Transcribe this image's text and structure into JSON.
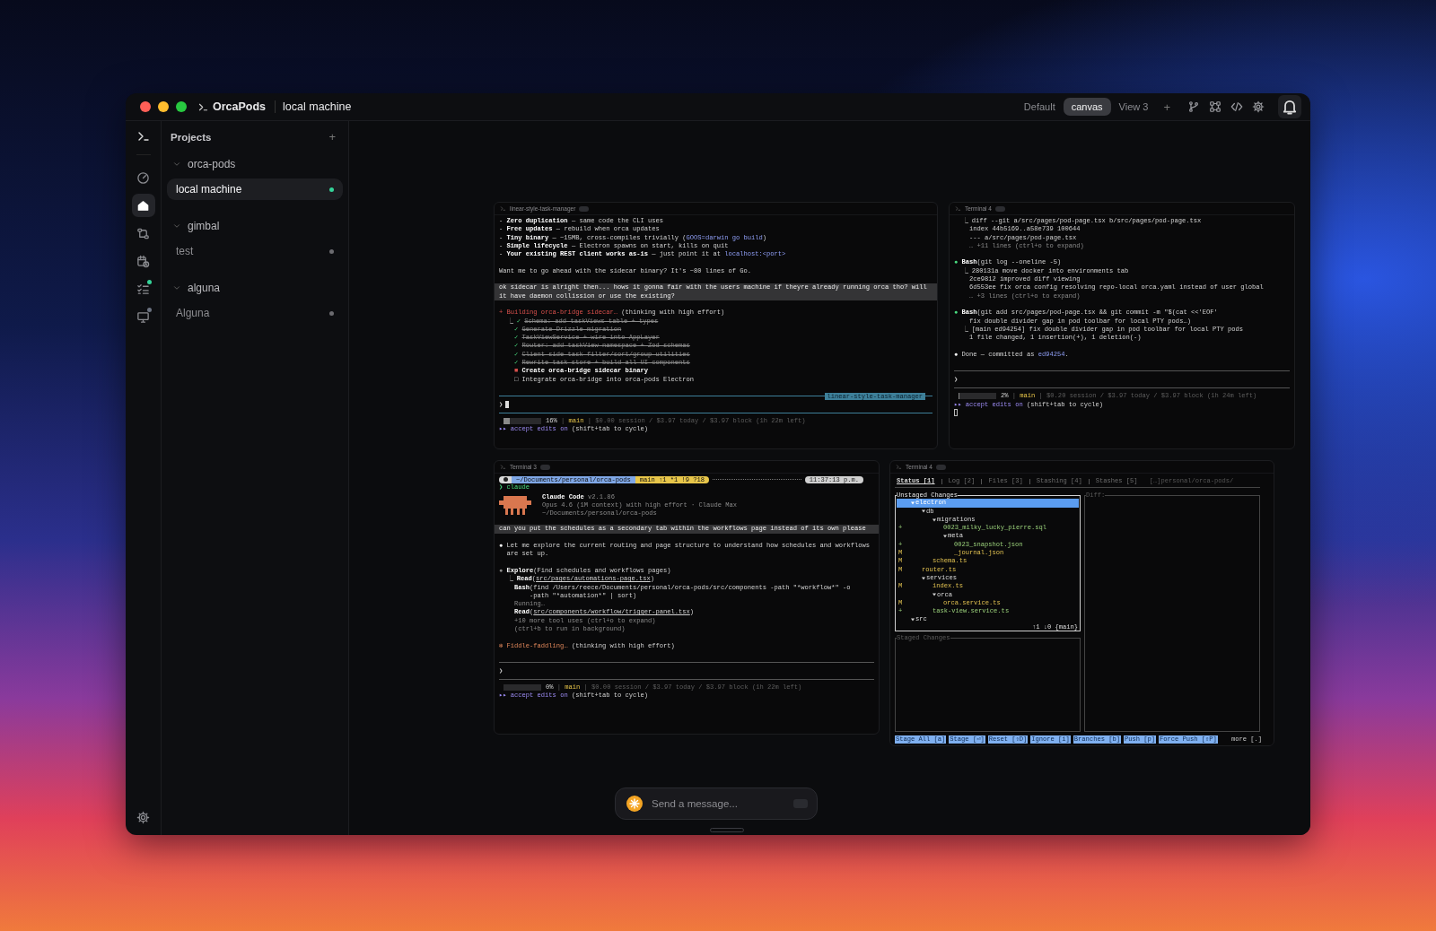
{
  "titlebar": {
    "app": "OrcaPods",
    "context": "local machine",
    "views": [
      {
        "label": "Default",
        "selected": false
      },
      {
        "label": "canvas",
        "selected": true
      },
      {
        "label": "View 3",
        "selected": false
      }
    ],
    "add_view": "+"
  },
  "rail": [
    {
      "selected": false
    },
    {
      "selected": true
    },
    {
      "selected": false
    },
    {
      "selected": false
    },
    {
      "selected": false,
      "color": "#34d399"
    },
    {
      "selected": false,
      "color": "#6b7280"
    }
  ],
  "projects": {
    "title": "Projects",
    "add": "+",
    "groups": [
      {
        "name": "orca-pods",
        "items": [
          {
            "label": "local machine",
            "selected": true,
            "color": "#34d399"
          }
        ]
      },
      {
        "name": "gimbal",
        "items": [
          {
            "label": "test",
            "selected": false,
            "color": "#6b6b70"
          }
        ]
      },
      {
        "name": "alguna",
        "items": [
          {
            "label": "Alguna",
            "selected": false,
            "color": "#6b6b70"
          }
        ]
      }
    ]
  },
  "terminals": [
    {
      "kind": "claude",
      "title": "linear-style-task-manager",
      "blocks": [
        {
          "kind": "line",
          "segments": [
            {
              "text": "- "
            },
            {
              "text": "Zero duplication",
              "kind": "bold"
            },
            {
              "text": " — same code the CLI uses"
            }
          ]
        },
        {
          "kind": "line",
          "segments": [
            {
              "text": "- "
            },
            {
              "text": "Free updates",
              "kind": "bold"
            },
            {
              "text": " — rebuild when orca updates"
            }
          ]
        },
        {
          "kind": "line",
          "segments": [
            {
              "text": "- "
            },
            {
              "text": "Tiny binary",
              "kind": "bold"
            },
            {
              "text": " — ~15MB, cross-compiles trivially ("
            },
            {
              "text": "GOOS=darwin go build",
              "kind": "link"
            },
            {
              "text": ")"
            }
          ]
        },
        {
          "kind": "line",
          "segments": [
            {
              "text": "- "
            },
            {
              "text": "Simple lifecycle",
              "kind": "bold"
            },
            {
              "text": " — Electron spawns on start, kills on quit"
            }
          ]
        },
        {
          "kind": "line",
          "segments": [
            {
              "text": "- "
            },
            {
              "text": "Your existing REST client works as-is",
              "kind": "bold"
            },
            {
              "text": " — just point it at "
            },
            {
              "text": "localhost:<port>",
              "kind": "link"
            }
          ]
        },
        {
          "kind": "blank"
        },
        {
          "kind": "line",
          "segments": [
            {
              "text": "Want me to go ahead with the sidecar binary? It's ~80 lines of Go."
            }
          ]
        },
        {
          "kind": "blank"
        },
        {
          "kind": "prompt",
          "text": "ok sidecar is alright then... hows it gonna fair with the users machine if theyre already running orca tho? will it have daemon collission or use the existing?"
        },
        {
          "kind": "blank"
        },
        {
          "kind": "line",
          "segments": [
            {
              "text": "+ Building orca-bridge sidecar…",
              "kind": "red"
            },
            {
              "text": " (thinking with high effort)"
            }
          ]
        },
        {
          "kind": "line",
          "segments": [
            {
              "kind": "indent"
            },
            {
              "text": "⎿ ",
              "kind": "dim"
            },
            {
              "text": "✓ ",
              "kind": "green"
            },
            {
              "text": "Schema: add taskViews table + types",
              "kind": "strike"
            }
          ]
        },
        {
          "kind": "line",
          "segments": [
            {
              "kind": "indent"
            },
            {
              "kind": "indent"
            },
            {
              "text": "✓ ",
              "kind": "green"
            },
            {
              "text": "Generate Drizzle migration",
              "kind": "strike"
            }
          ]
        },
        {
          "kind": "line",
          "segments": [
            {
              "kind": "indent"
            },
            {
              "kind": "indent"
            },
            {
              "text": "✓ ",
              "kind": "green"
            },
            {
              "text": "TaskViewService + wire into AppLayer",
              "kind": "strike"
            }
          ]
        },
        {
          "kind": "line",
          "segments": [
            {
              "kind": "indent"
            },
            {
              "kind": "indent"
            },
            {
              "text": "✓ ",
              "kind": "green"
            },
            {
              "text": "Router: add taskView namespace + Zod schemas",
              "kind": "strike"
            }
          ]
        },
        {
          "kind": "line",
          "segments": [
            {
              "kind": "indent"
            },
            {
              "kind": "indent"
            },
            {
              "text": "✓ ",
              "kind": "green"
            },
            {
              "text": "Client-side task filter/sort/group utilities",
              "kind": "strike"
            }
          ]
        },
        {
          "kind": "line",
          "segments": [
            {
              "kind": "indent"
            },
            {
              "kind": "indent"
            },
            {
              "text": "✓ ",
              "kind": "green"
            },
            {
              "text": "Rewrite task store + build all UI components",
              "kind": "strike"
            }
          ]
        },
        {
          "kind": "line",
          "segments": [
            {
              "kind": "indent"
            },
            {
              "kind": "indent"
            },
            {
              "text": "■ ",
              "kind": "red"
            },
            {
              "text": "Create orca-bridge sidecar binary",
              "kind": "bold"
            }
          ]
        },
        {
          "kind": "line",
          "segments": [
            {
              "kind": "indent"
            },
            {
              "kind": "indent"
            },
            {
              "text": "□ Integrate orca-bridge into orca-pods Electron"
            }
          ]
        },
        {
          "kind": "blank"
        },
        {
          "kind": "rule",
          "label": "linear-style-task-manager",
          "color": "#3d7f99"
        },
        {
          "kind": "input",
          "text": "❯",
          "cursor": true
        },
        {
          "kind": "rule",
          "color": "#3d7f99"
        },
        {
          "kind": "status",
          "level": 0.16,
          "segments": [
            {
              "text": "16%"
            },
            {
              "text": " | ",
              "kind": "faint"
            },
            {
              "text": "main",
              "kind": "yellow"
            },
            {
              "text": " | $0.00 session / $3.97 today / $3.97 block (1h 22m left)",
              "kind": "faint"
            }
          ]
        },
        {
          "kind": "line",
          "segments": [
            {
              "text": "▸▸ accept edits on",
              "kind": "purple"
            },
            {
              "text": " (shift+tab to cycle)"
            }
          ]
        }
      ]
    },
    {
      "kind": "claude",
      "title": "Terminal 4",
      "blocks": [
        {
          "kind": "line",
          "segments": [
            {
              "kind": "indent"
            },
            {
              "text": "⎿ ",
              "kind": "dim"
            },
            {
              "text": "diff --git a/src/pages/pod-page.tsx b/src/pages/pod-page.tsx"
            }
          ]
        },
        {
          "kind": "line",
          "segments": [
            {
              "kind": "indent"
            },
            {
              "kind": "indent"
            },
            {
              "text": "index 44b5169..a58e739 100644"
            }
          ]
        },
        {
          "kind": "line",
          "segments": [
            {
              "kind": "indent"
            },
            {
              "kind": "indent"
            },
            {
              "text": "--- a/src/pages/pod-page.tsx"
            }
          ]
        },
        {
          "kind": "line",
          "segments": [
            {
              "kind": "indent"
            },
            {
              "kind": "indent"
            },
            {
              "text": "… +11 lines (ctrl+o to expand)",
              "kind": "dim"
            }
          ]
        },
        {
          "kind": "blank"
        },
        {
          "kind": "line",
          "segments": [
            {
              "text": "● ",
              "kind": "green"
            },
            {
              "text": "Bash",
              "kind": "bold"
            },
            {
              "text": "(git log --oneline -5)"
            }
          ]
        },
        {
          "kind": "line",
          "segments": [
            {
              "kind": "indent"
            },
            {
              "text": "⎿ ",
              "kind": "dim"
            },
            {
              "text": "280131a move docker into environments tab"
            }
          ]
        },
        {
          "kind": "line",
          "segments": [
            {
              "kind": "indent"
            },
            {
              "kind": "indent"
            },
            {
              "text": "2ce9812 improved diff viewing"
            }
          ]
        },
        {
          "kind": "line",
          "segments": [
            {
              "kind": "indent"
            },
            {
              "kind": "indent"
            },
            {
              "text": "6d553ee fix orca config resolving repo-local orca.yaml instead of user global"
            }
          ]
        },
        {
          "kind": "line",
          "segments": [
            {
              "kind": "indent"
            },
            {
              "kind": "indent"
            },
            {
              "text": "… +3 lines (ctrl+o to expand)",
              "kind": "dim"
            }
          ]
        },
        {
          "kind": "blank"
        },
        {
          "kind": "line",
          "segments": [
            {
              "text": "● ",
              "kind": "green"
            },
            {
              "text": "Bash",
              "kind": "bold"
            },
            {
              "text": "(git add src/pages/pod-page.tsx && git commit -m \"$(cat <<'EOF'"
            }
          ]
        },
        {
          "kind": "line",
          "segments": [
            {
              "kind": "indent"
            },
            {
              "kind": "indent"
            },
            {
              "text": "fix double divider gap in pod toolbar for local PTY pods…)"
            }
          ]
        },
        {
          "kind": "line",
          "segments": [
            {
              "kind": "indent"
            },
            {
              "text": "⎿ ",
              "kind": "dim"
            },
            {
              "text": "[main ed94254] fix double divider gap in pod toolbar for local PTY pods"
            }
          ]
        },
        {
          "kind": "line",
          "segments": [
            {
              "kind": "indent"
            },
            {
              "kind": "indent"
            },
            {
              "text": "1 file changed, 1 insertion(+), 1 deletion(-)"
            }
          ]
        },
        {
          "kind": "blank"
        },
        {
          "kind": "line",
          "segments": [
            {
              "text": "● ",
              "kind": "white"
            },
            {
              "text": "Done — committed as "
            },
            {
              "text": "ed94254",
              "kind": "link"
            },
            {
              "text": "."
            }
          ]
        },
        {
          "kind": "blank"
        },
        {
          "kind": "rule"
        },
        {
          "kind": "input",
          "text": "❯",
          "cursor": false
        },
        {
          "kind": "rule"
        },
        {
          "kind": "status",
          "level": 0.02,
          "segments": [
            {
              "text": "2%"
            },
            {
              "text": " | ",
              "kind": "faint"
            },
            {
              "text": "main",
              "kind": "yellow"
            },
            {
              "text": " | $0.20 session / $3.97 today / $3.97 block (1h 24m left)",
              "kind": "faint"
            }
          ]
        },
        {
          "kind": "line",
          "segments": [
            {
              "text": "▸▸ accept edits on",
              "kind": "purple"
            },
            {
              "text": " (shift+tab to cycle)"
            }
          ]
        },
        {
          "kind": "cursor"
        }
      ]
    },
    {
      "kind": "claude",
      "title": "Terminal 3",
      "blocks": [
        {
          "kind": "powerline",
          "parts": [
            {
              "color": "#d9d9d9"
            },
            {
              "text": "~/Documents/personal/orca-pods",
              "color": "#7fa7e6"
            },
            {
              "text": "main ↑1 *1 !9 ?18",
              "color": "#e8c64a"
            }
          ],
          "time": "11:37:13 p.m."
        },
        {
          "kind": "line",
          "segments": [
            {
              "text": "❯ claude",
              "kind": "green"
            }
          ]
        },
        {
          "kind": "banner",
          "lines": [
            {
              "segments": [
                {
                  "text": "Claude Code",
                  "kind": "bold"
                },
                {
                  "text": " v2.1.86",
                  "kind": "dim"
                }
              ]
            },
            {
              "segments": [
                {
                  "text": "Opus 4.6 (1M context) with high effort · Claude Max",
                  "kind": "dim"
                }
              ]
            },
            {
              "segments": [
                {
                  "text": "~/Documents/personal/orca-pods",
                  "kind": "dim"
                }
              ]
            }
          ]
        },
        {
          "kind": "prompt",
          "text": "can you put the schedules as a secondary tab within the workflows page instead of its own please"
        },
        {
          "kind": "blank"
        },
        {
          "kind": "line",
          "segments": [
            {
              "text": "● ",
              "kind": "white"
            },
            {
              "text": "Let me explore the current routing and page structure to understand how schedules and workflows"
            }
          ]
        },
        {
          "kind": "line",
          "segments": [
            {
              "kind": "indent"
            },
            {
              "text": "are set up."
            }
          ]
        },
        {
          "kind": "blank"
        },
        {
          "kind": "line",
          "segments": [
            {
              "text": "● ",
              "kind": "dim"
            },
            {
              "text": "Explore",
              "kind": "bold"
            },
            {
              "text": "(Find schedules and workflows pages)"
            }
          ]
        },
        {
          "kind": "line",
          "segments": [
            {
              "kind": "indent"
            },
            {
              "text": "⎿ ",
              "kind": "dim"
            },
            {
              "text": "Read",
              "kind": "bold"
            },
            {
              "text": "("
            },
            {
              "text": "src/pages/automations-page.tsx",
              "kind": "underline"
            },
            {
              "text": ")"
            }
          ]
        },
        {
          "kind": "line",
          "segments": [
            {
              "kind": "indent"
            },
            {
              "kind": "indent"
            },
            {
              "text": "Bash",
              "kind": "bold"
            },
            {
              "text": "(find /Users/reece/Documents/personal/orca-pods/src/components -path \"*workflow*\" -o"
            }
          ]
        },
        {
          "kind": "line",
          "segments": [
            {
              "kind": "indent"
            },
            {
              "kind": "indent"
            },
            {
              "kind": "indent"
            },
            {
              "kind": "indent"
            },
            {
              "text": "-path \"*automation*\" | sort)"
            }
          ]
        },
        {
          "kind": "line",
          "segments": [
            {
              "kind": "indent"
            },
            {
              "kind": "indent"
            },
            {
              "text": "Running…",
              "kind": "dim"
            }
          ]
        },
        {
          "kind": "line",
          "segments": [
            {
              "kind": "indent"
            },
            {
              "kind": "indent"
            },
            {
              "text": "Read",
              "kind": "bold"
            },
            {
              "text": "("
            },
            {
              "text": "src/components/workflow/trigger-panel.tsx",
              "kind": "underline"
            },
            {
              "text": ")"
            }
          ]
        },
        {
          "kind": "line",
          "segments": [
            {
              "kind": "indent"
            },
            {
              "kind": "indent"
            },
            {
              "text": "+10 more tool uses (ctrl+o to expand)",
              "kind": "dim"
            }
          ]
        },
        {
          "kind": "line",
          "segments": [
            {
              "kind": "indent"
            },
            {
              "kind": "indent"
            },
            {
              "text": "(ctrl+b to run in background)",
              "kind": "dim"
            }
          ]
        },
        {
          "kind": "blank"
        },
        {
          "kind": "line",
          "segments": [
            {
              "text": "✻ Fiddle-faddling…",
              "kind": "orange"
            },
            {
              "text": " (thinking with high effort)"
            }
          ]
        },
        {
          "kind": "blank"
        },
        {
          "kind": "rule"
        },
        {
          "kind": "input",
          "text": "❯",
          "cursor": false
        },
        {
          "kind": "rule"
        },
        {
          "kind": "status",
          "level": 0,
          "segments": [
            {
              "text": "0%"
            },
            {
              "text": " | ",
              "kind": "faint"
            },
            {
              "text": "main",
              "kind": "yellow"
            },
            {
              "text": " | $0.00 session / $3.97 today / $3.97 block (1h 22m left)",
              "kind": "faint"
            }
          ]
        },
        {
          "kind": "line",
          "segments": [
            {
              "text": "▸▸ accept edits on",
              "kind": "purple"
            },
            {
              "text": " (shift+tab to cycle)"
            }
          ]
        }
      ]
    },
    {
      "kind": "lazygit",
      "title": "Terminal 4",
      "tabs": [
        {
          "label": "Status [1]",
          "selected": true
        },
        {
          "label": "Log [2]",
          "selected": false
        },
        {
          "label": "Files [3]",
          "selected": false
        },
        {
          "label": "Stashing [4]",
          "selected": false
        },
        {
          "label": "Stashes [5]",
          "selected": false
        }
      ],
      "path": "[…]personal/orca-pods/",
      "unstaged": {
        "title": "Unstaged Changes",
        "footer": "↑1 ↓0 {main}",
        "tree": [
          {
            "name": "electron",
            "kind": "dir",
            "selected": true,
            "children": [
              {
                "name": "db",
                "kind": "dir",
                "selected": false,
                "children": [
                  {
                    "name": "migrations",
                    "kind": "dir",
                    "selected": false,
                    "children": [
                      {
                        "name": "0023_milky_lucky_pierre.sql",
                        "kind": "added",
                        "change": "+",
                        "selected": false
                      },
                      {
                        "name": "meta",
                        "kind": "dir",
                        "selected": false,
                        "children": [
                          {
                            "name": "0023_snapshot.json",
                            "kind": "added",
                            "change": "+",
                            "selected": false
                          },
                          {
                            "name": "_journal.json",
                            "kind": "modified",
                            "change": "M",
                            "selected": false
                          }
                        ]
                      }
                    ]
                  },
                  {
                    "name": "schema.ts",
                    "kind": "modified",
                    "change": "M",
                    "selected": false
                  }
                ]
              },
              {
                "name": "router.ts",
                "kind": "modified",
                "change": "M",
                "selected": false
              },
              {
                "name": "services",
                "kind": "dir",
                "selected": false,
                "children": [
                  {
                    "name": "index.ts",
                    "kind": "modified",
                    "change": "M",
                    "selected": false
                  },
                  {
                    "name": "orca",
                    "kind": "dir",
                    "selected": false,
                    "children": [
                      {
                        "name": "orca.service.ts",
                        "kind": "modified",
                        "change": "M",
                        "selected": false
                      }
                    ]
                  },
                  {
                    "name": "task-view.service.ts",
                    "kind": "added",
                    "change": "+",
                    "selected": false
                  }
                ]
              }
            ]
          },
          {
            "name": "src",
            "kind": "dir",
            "selected": false
          }
        ]
      },
      "staged": {
        "title": "Staged Changes"
      },
      "diff": {
        "title": "Diff:"
      },
      "keys": [
        "Stage All [a]",
        "Stage [⏎]",
        "Reset [⇧D]",
        "Ignore [i]",
        "Branches [b]",
        "Push [p]",
        "Force Push [⇧P]"
      ],
      "more": "more [.]"
    }
  ],
  "composer": {
    "placeholder": "Send a message..."
  }
}
